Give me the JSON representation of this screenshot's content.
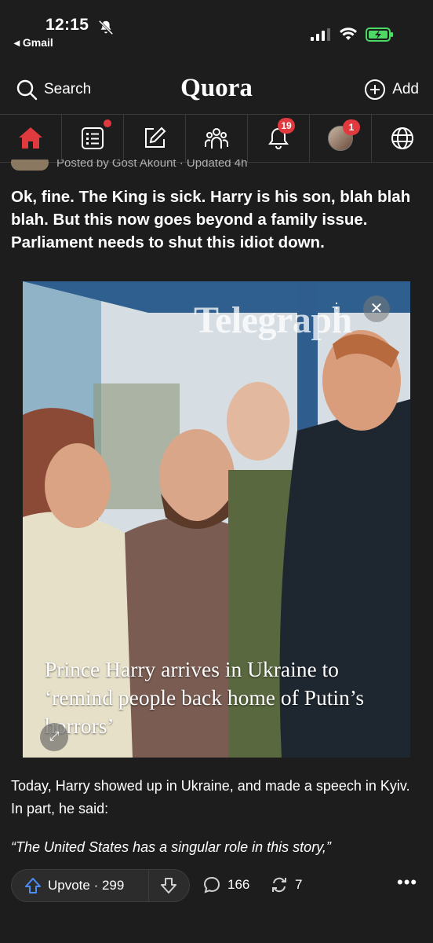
{
  "status_bar": {
    "time": "12:15",
    "back_app": "◂ Gmail"
  },
  "header": {
    "search_label": "Search",
    "logo": "Quora",
    "add_label": "Add"
  },
  "nav": {
    "notifications_badge": "19",
    "profile_badge": "1",
    "accent_color": "#e0393e"
  },
  "post": {
    "posted_line": "Posted by Gost Akount  ·  Updated 4h",
    "title": "Ok, fine. The King is sick. Harry is his son, blah blah blah. But this now goes beyond a family issue. Parliament needs to shut this idiot down.",
    "image": {
      "watermark": "Telegraph",
      "caption": "Prince Harry arrives in Ukraine to ‘remind people back home of Putin’s horrors’"
    },
    "paragraph": "Today, Harry showed up in Ukraine, and made a speech in Kyiv. In part, he said:",
    "quote": "“The United States has a singular role in this story,”"
  },
  "actions": {
    "upvote_label": "Upvote · 299",
    "comments": "166",
    "shares": "7",
    "more": "•••"
  }
}
